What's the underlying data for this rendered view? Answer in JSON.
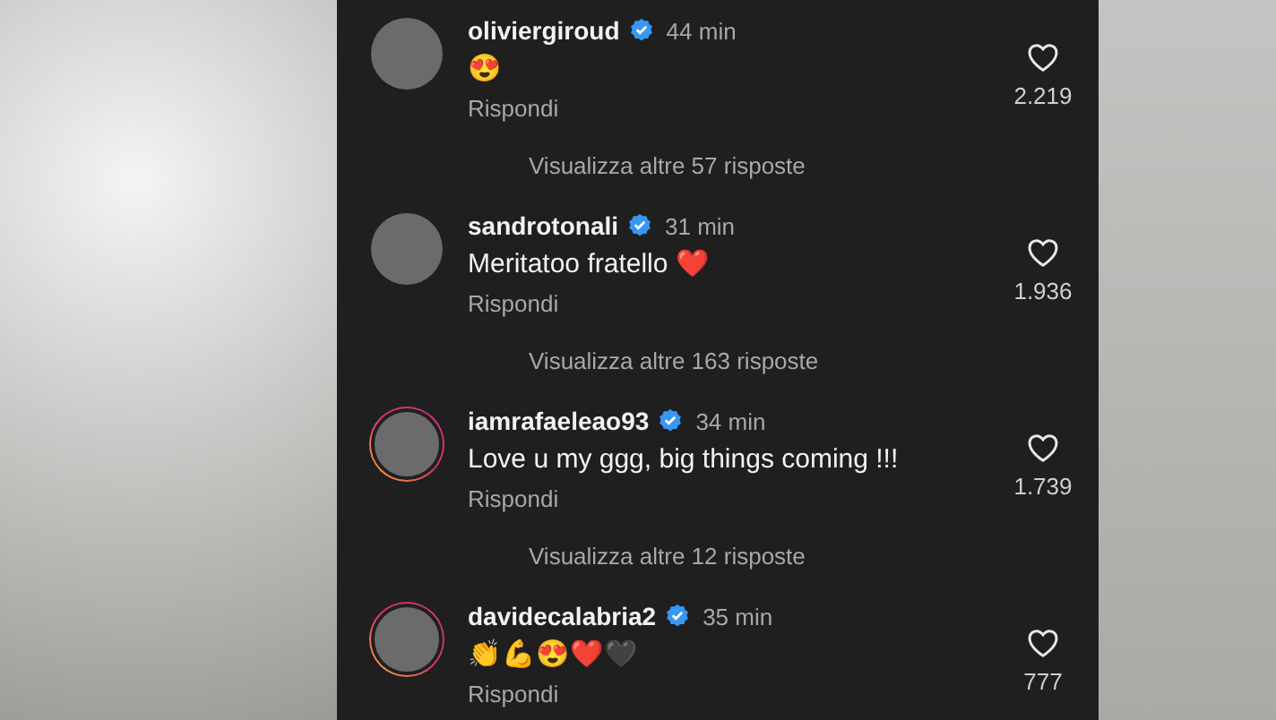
{
  "comments": [
    {
      "username": "oliviergiroud",
      "verified": true,
      "time": "44 min",
      "text": "😍",
      "reply": "Rispondi",
      "likes": "2.219",
      "story": false,
      "view_more": "Visualizza altre 57 risposte"
    },
    {
      "username": "sandrotonali",
      "verified": true,
      "time": "31 min",
      "text": "Meritatoo fratello ❤️",
      "reply": "Rispondi",
      "likes": "1.936",
      "story": false,
      "view_more": "Visualizza altre 163 risposte"
    },
    {
      "username": "iamrafaeleao93",
      "verified": true,
      "time": "34 min",
      "text": "Love u my ggg, big things coming !!!",
      "reply": "Rispondi",
      "likes": "1.739",
      "story": true,
      "view_more": "Visualizza altre 12 risposte"
    },
    {
      "username": "davidecalabria2",
      "verified": true,
      "time": "35 min",
      "text": "👏💪😍❤️🖤",
      "reply": "Rispondi",
      "likes": "777",
      "story": true
    }
  ]
}
